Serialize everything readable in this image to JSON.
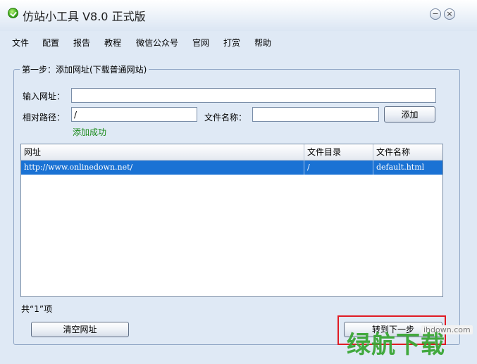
{
  "window": {
    "title": "仿站小工具 V8.0 正式版",
    "min_glyph": "−",
    "close_glyph": "×"
  },
  "menu": {
    "items": [
      "文件",
      "配置",
      "报告",
      "教程",
      "微信公众号",
      "官网",
      "打赏",
      "帮助"
    ]
  },
  "step1": {
    "group_label": "第一步：添加网址(下载普通网站)",
    "url_label": "输入网址：",
    "url_value": "",
    "path_label": "相对路径：",
    "path_value": "/",
    "filename_label": "文件名称：",
    "filename_value": "",
    "add_button": "添加",
    "success_message": "添加成功"
  },
  "table": {
    "columns": [
      "网址",
      "文件目录",
      "文件名称"
    ],
    "rows": [
      {
        "url": "http://www.onlinedown.net/",
        "dir": "/",
        "file": "default.html",
        "selected": true
      }
    ]
  },
  "footer": {
    "count_text": "共“1”项",
    "clear_button": "清空网址",
    "next_button": "转到下一步"
  },
  "watermark": {
    "site": "ihdown.com",
    "logo": "绿航下载"
  },
  "colors": {
    "background": "#dfe9f5",
    "selection": "#1a72d4",
    "success": "#1a8a1a",
    "highlight_border": "#e01b24"
  }
}
